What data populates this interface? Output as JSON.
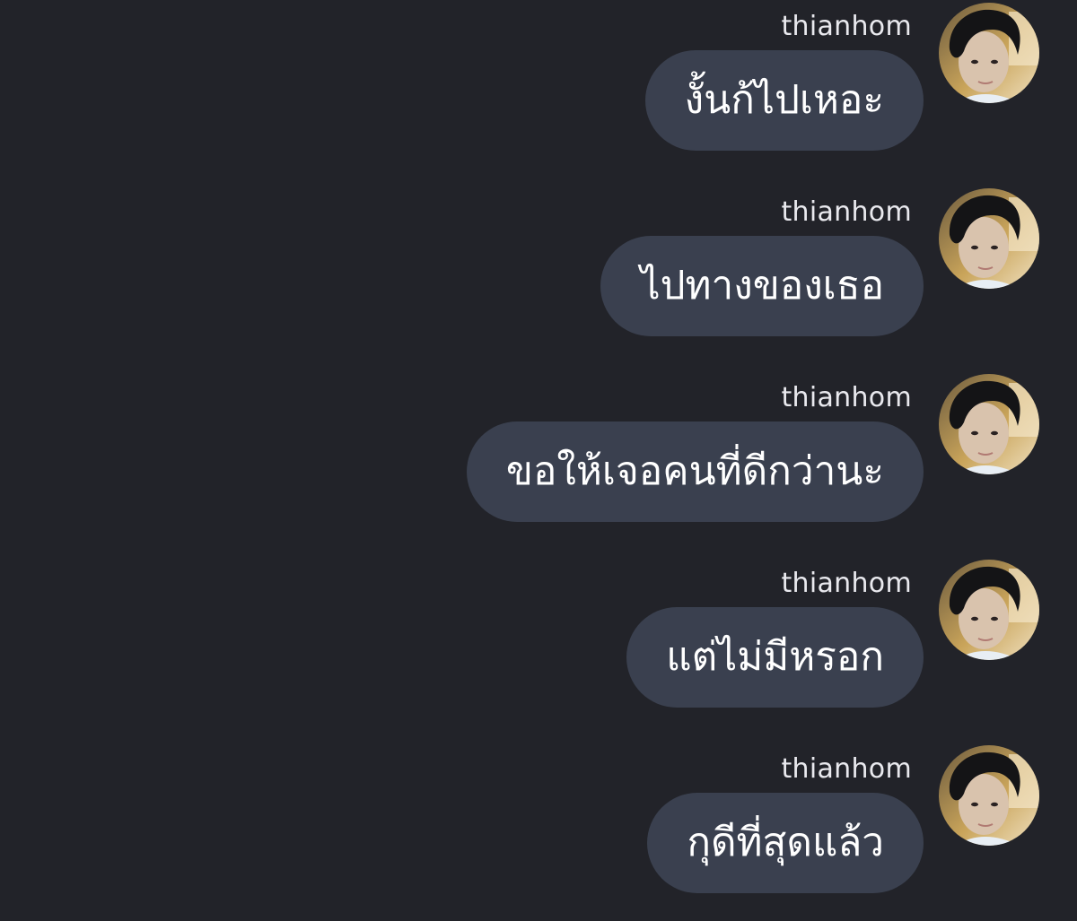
{
  "messages": [
    {
      "sender": "thianhom",
      "text": "งั้นก้ไปเหอะ"
    },
    {
      "sender": "thianhom",
      "text": "ไปทางของเธอ"
    },
    {
      "sender": "thianhom",
      "text": "ขอให้เจอคนที่ดีกว่านะ"
    },
    {
      "sender": "thianhom",
      "text": "แต่ไม่มีหรอก"
    },
    {
      "sender": "thianhom",
      "text": "กุดีที่สุดแล้ว"
    }
  ],
  "colors": {
    "background": "#222329",
    "bubble": "#3a404f",
    "text": "#ffffff",
    "sender": "#e9e9ee"
  },
  "icons": {
    "avatar": "user-photo-avatar"
  }
}
